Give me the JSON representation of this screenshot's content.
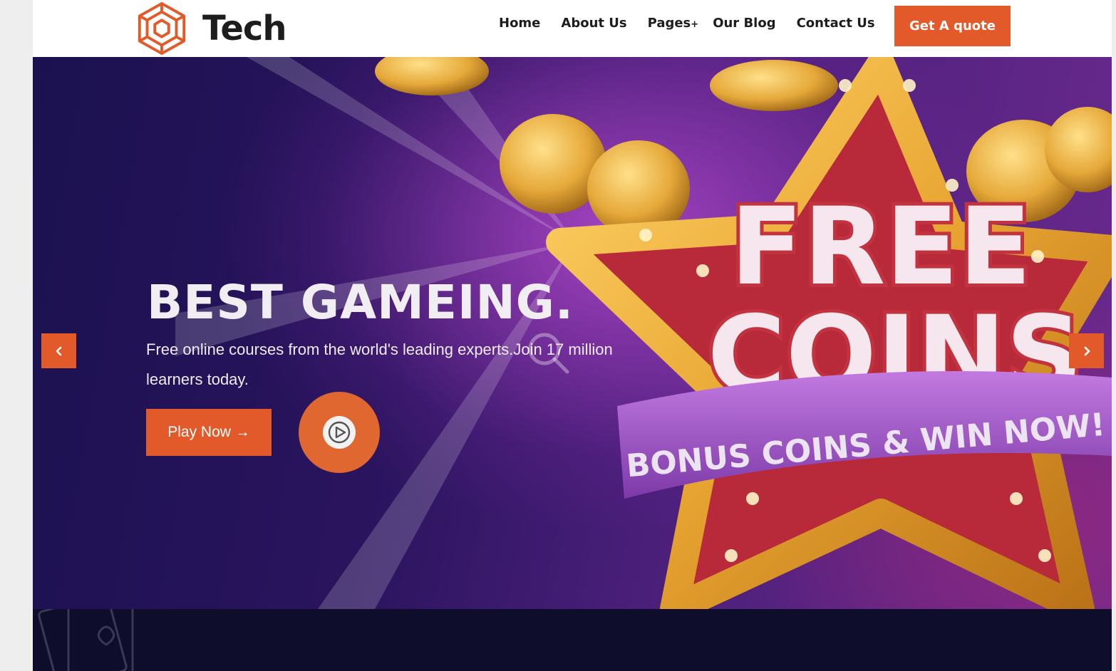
{
  "header": {
    "logo_text": "Tech",
    "logo_icon": "hex-circuit-icon",
    "nav": [
      {
        "label": "Home"
      },
      {
        "label": "About Us"
      },
      {
        "label": "Pages",
        "suffix": "+"
      },
      {
        "label": "Our Blog"
      },
      {
        "label": "Contact Us"
      }
    ],
    "cta_label": "Get A quote"
  },
  "hero": {
    "title": "BEST GAMEING.",
    "subtitle": "Free online courses from the world's leading experts.Join 17 million learners today.",
    "play_label": "Play Now",
    "play_arrow": "→",
    "banner_word1": "FREE",
    "banner_word2": "COINS",
    "ribbon_text": "BONUS COINS & WIN NOW!",
    "prev_icon": "chevron-left-icon",
    "next_icon": "chevron-right-icon",
    "video_icon": "play-circle-icon"
  },
  "colors": {
    "accent": "#e35a2a",
    "hero_dark": "#1b1150",
    "hero_purple": "#6b2a8e",
    "text_dark": "#1d1d1d"
  }
}
